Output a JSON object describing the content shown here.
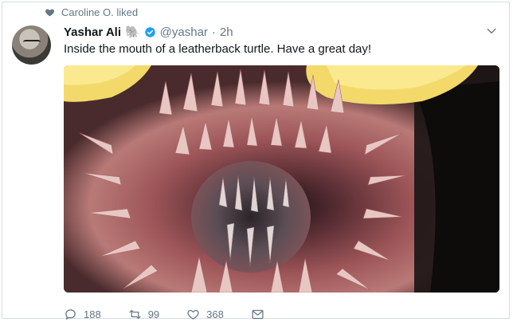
{
  "social_context": {
    "text": "Caroline O. liked",
    "icon": "heart-icon"
  },
  "tweet": {
    "display_name": "Yashar Ali",
    "name_emoji": "🐘",
    "verified": true,
    "handle": "@yashar",
    "separator": "·",
    "time": "2h",
    "text": "Inside the mouth of a leatherback turtle. Have a great day!"
  },
  "actions": {
    "replies": "188",
    "retweets": "99",
    "likes": "368"
  },
  "colors": {
    "accent": "#1da1f2",
    "secondary_text": "#657786",
    "primary_text": "#14171a"
  }
}
